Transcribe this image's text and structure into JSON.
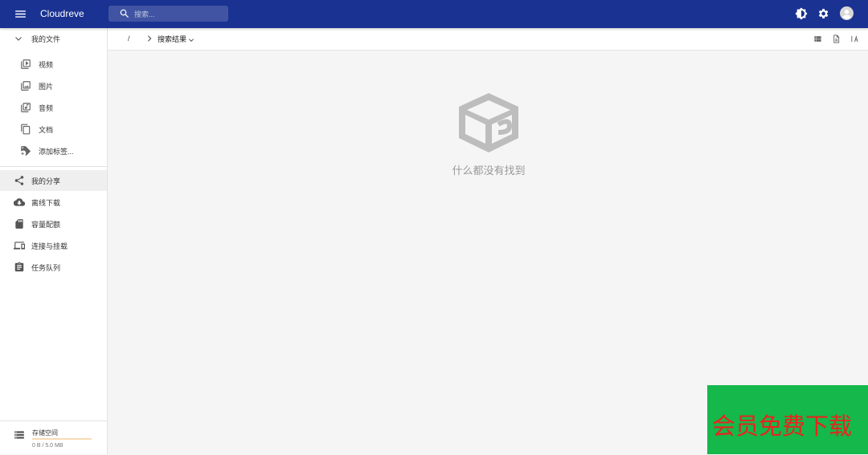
{
  "appbar": {
    "title": "Cloudreve",
    "search_placeholder": "搜索..."
  },
  "sidebar": {
    "my_files": "我的文件",
    "file_types": [
      {
        "label": "视频",
        "icon": "video-icon"
      },
      {
        "label": "图片",
        "icon": "image-icon"
      },
      {
        "label": "音频",
        "icon": "audio-icon"
      },
      {
        "label": "文档",
        "icon": "document-icon"
      },
      {
        "label": "添加标签...",
        "icon": "tag-plus-icon"
      }
    ],
    "nav": [
      {
        "label": "我的分享",
        "icon": "share-icon"
      },
      {
        "label": "离线下载",
        "icon": "cloud-download-icon"
      },
      {
        "label": "容量配额",
        "icon": "sd-card-icon"
      },
      {
        "label": "连接与挂载",
        "icon": "devices-icon"
      },
      {
        "label": "任务队列",
        "icon": "clipboard-icon"
      }
    ],
    "storage": {
      "title": "存储空间",
      "usage": "0 B / 5.0 MB",
      "used_fraction": 0
    }
  },
  "breadcrumb": {
    "root": "/",
    "current": "搜索结果"
  },
  "empty": {
    "message": "什么都没有找到"
  },
  "ad": {
    "text": "会员免费下载"
  },
  "colors": {
    "appbar": "#1a3291",
    "ad_background": "#14b84b",
    "ad_text": "#e8241c"
  }
}
